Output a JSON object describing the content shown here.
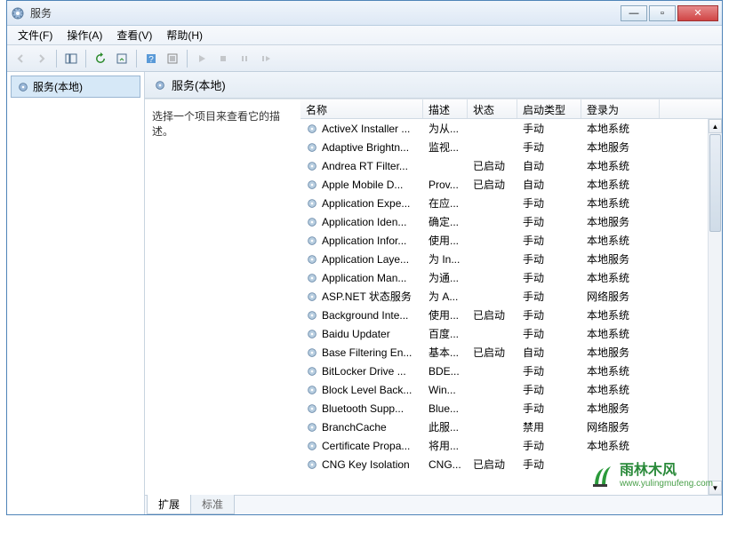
{
  "window": {
    "title": "服务"
  },
  "menu": {
    "file": "文件(F)",
    "action": "操作(A)",
    "view": "查看(V)",
    "help": "帮助(H)"
  },
  "leftTree": {
    "root": "服务(本地)"
  },
  "paneHeader": "服务(本地)",
  "descPrompt": "选择一个项目来查看它的描述。",
  "columns": {
    "name": "名称",
    "desc": "描述",
    "status": "状态",
    "startType": "启动类型",
    "logonAs": "登录为"
  },
  "tabs": {
    "extended": "扩展",
    "standard": "标准"
  },
  "services": [
    {
      "name": "ActiveX Installer ...",
      "desc": "为从...",
      "status": "",
      "startType": "手动",
      "logonAs": "本地系统"
    },
    {
      "name": "Adaptive Brightn...",
      "desc": "监视...",
      "status": "",
      "startType": "手动",
      "logonAs": "本地服务"
    },
    {
      "name": "Andrea RT Filter...",
      "desc": "",
      "status": "已启动",
      "startType": "自动",
      "logonAs": "本地系统"
    },
    {
      "name": "Apple Mobile D...",
      "desc": "Prov...",
      "status": "已启动",
      "startType": "自动",
      "logonAs": "本地系统"
    },
    {
      "name": "Application Expe...",
      "desc": "在应...",
      "status": "",
      "startType": "手动",
      "logonAs": "本地系统"
    },
    {
      "name": "Application Iden...",
      "desc": "确定...",
      "status": "",
      "startType": "手动",
      "logonAs": "本地服务"
    },
    {
      "name": "Application Infor...",
      "desc": "使用...",
      "status": "",
      "startType": "手动",
      "logonAs": "本地系统"
    },
    {
      "name": "Application Laye...",
      "desc": "为 In...",
      "status": "",
      "startType": "手动",
      "logonAs": "本地服务"
    },
    {
      "name": "Application Man...",
      "desc": "为通...",
      "status": "",
      "startType": "手动",
      "logonAs": "本地系统"
    },
    {
      "name": "ASP.NET 状态服务",
      "desc": "为 A...",
      "status": "",
      "startType": "手动",
      "logonAs": "网络服务"
    },
    {
      "name": "Background Inte...",
      "desc": "使用...",
      "status": "已启动",
      "startType": "手动",
      "logonAs": "本地系统"
    },
    {
      "name": "Baidu Updater",
      "desc": "百度...",
      "status": "",
      "startType": "手动",
      "logonAs": "本地系统"
    },
    {
      "name": "Base Filtering En...",
      "desc": "基本...",
      "status": "已启动",
      "startType": "自动",
      "logonAs": "本地服务"
    },
    {
      "name": "BitLocker Drive ...",
      "desc": "BDE...",
      "status": "",
      "startType": "手动",
      "logonAs": "本地系统"
    },
    {
      "name": "Block Level Back...",
      "desc": "Win...",
      "status": "",
      "startType": "手动",
      "logonAs": "本地系统"
    },
    {
      "name": "Bluetooth Supp...",
      "desc": "Blue...",
      "status": "",
      "startType": "手动",
      "logonAs": "本地服务"
    },
    {
      "name": "BranchCache",
      "desc": "此服...",
      "status": "",
      "startType": "禁用",
      "logonAs": "网络服务"
    },
    {
      "name": "Certificate Propa...",
      "desc": "将用...",
      "status": "",
      "startType": "手动",
      "logonAs": "本地系统"
    },
    {
      "name": "CNG Key Isolation",
      "desc": "CNG...",
      "status": "已启动",
      "startType": "手动",
      "logonAs": ""
    }
  ],
  "watermark": {
    "cn": "雨林木风",
    "url": "www.yulingmufeng.com"
  }
}
